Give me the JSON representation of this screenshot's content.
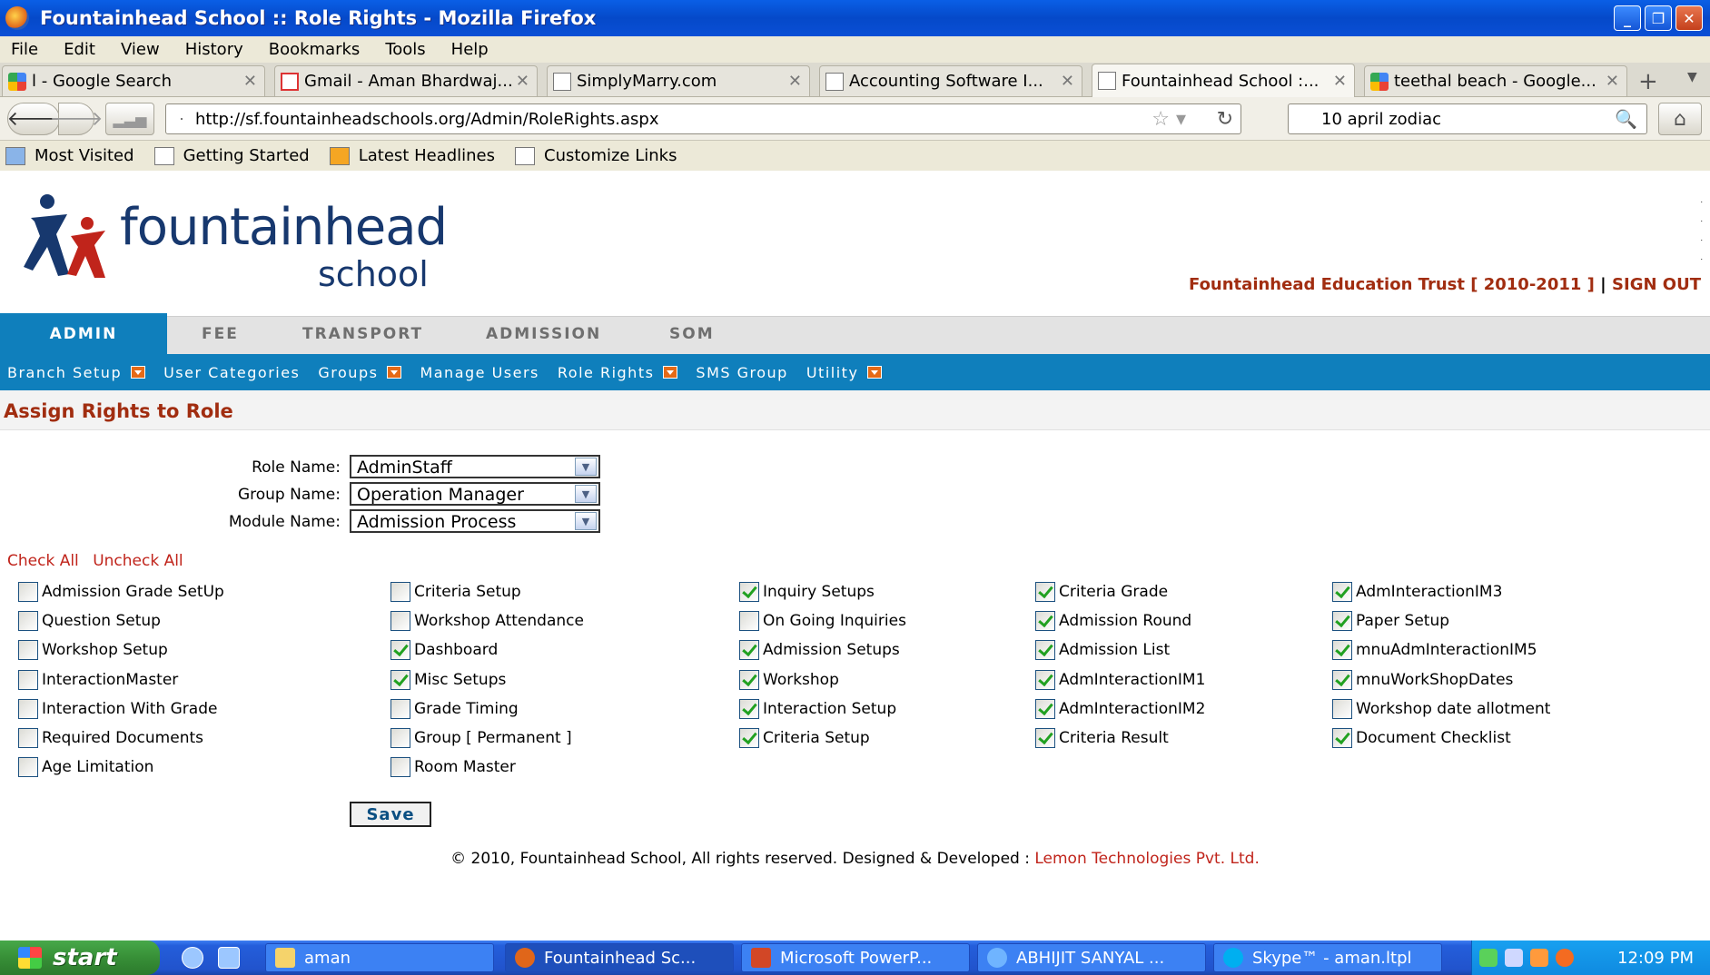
{
  "window": {
    "title": "Fountainhead School :: Role Rights - Mozilla Firefox"
  },
  "menubar": [
    "File",
    "Edit",
    "View",
    "History",
    "Bookmarks",
    "Tools",
    "Help"
  ],
  "tabs": [
    {
      "label": "l - Google Search",
      "icon": "google-icon",
      "active": false
    },
    {
      "label": "Gmail - Aman Bhardwaj...",
      "icon": "gmail-icon",
      "active": false
    },
    {
      "label": "SimplyMarry.com",
      "icon": "page-icon",
      "active": false
    },
    {
      "label": "Accounting Software I...",
      "icon": "page-icon",
      "active": false
    },
    {
      "label": "Fountainhead School :...",
      "icon": "page-icon",
      "active": true
    },
    {
      "label": "teethal beach - Google...",
      "icon": "google-icon",
      "active": false
    }
  ],
  "nav": {
    "url": "http://sf.fountainheadschools.org/Admin/RoleRights.aspx",
    "search": "10 april zodiac"
  },
  "bookmarks": [
    "Most Visited",
    "Getting Started",
    "Latest Headlines",
    "Customize Links"
  ],
  "site": {
    "logo_line1": "fountainhead",
    "logo_line2": "school",
    "trust": "Fountainhead Education Trust [ 2010-2011 ]",
    "separator": "|",
    "signout": "SIGN OUT"
  },
  "main_tabs": [
    "ADMIN",
    "FEE",
    "TRANSPORT",
    "ADMISSION",
    "SOM"
  ],
  "submenu": [
    {
      "label": "Branch Setup",
      "dropdown": true
    },
    {
      "label": "User Categories",
      "dropdown": false
    },
    {
      "label": "Groups",
      "dropdown": true
    },
    {
      "label": "Manage Users",
      "dropdown": false
    },
    {
      "label": "Role Rights",
      "dropdown": true
    },
    {
      "label": "SMS Group",
      "dropdown": false
    },
    {
      "label": "Utility",
      "dropdown": true
    }
  ],
  "form": {
    "heading": "Assign Rights to Role",
    "role_label": "Role Name:",
    "role_value": "AdminStaff",
    "group_label": "Group Name:",
    "group_value": "Operation Manager",
    "module_label": "Module Name:",
    "module_value": "Admission Process",
    "check_all": "Check All",
    "uncheck_all": "Uncheck All",
    "save": "Save"
  },
  "rights_columns": [
    [
      {
        "label": "Admission Grade SetUp",
        "checked": false
      },
      {
        "label": "Question Setup",
        "checked": false
      },
      {
        "label": "Workshop Setup",
        "checked": false
      },
      {
        "label": "InteractionMaster",
        "checked": false
      },
      {
        "label": "Interaction With Grade",
        "checked": false
      },
      {
        "label": "Required Documents",
        "checked": false
      },
      {
        "label": "Age Limitation",
        "checked": false
      }
    ],
    [
      {
        "label": "Criteria Setup",
        "checked": false
      },
      {
        "label": "Workshop Attendance",
        "checked": false
      },
      {
        "label": "Dashboard",
        "checked": true
      },
      {
        "label": "Misc Setups",
        "checked": true
      },
      {
        "label": "Grade Timing",
        "checked": false
      },
      {
        "label": "Group [ Permanent ]",
        "checked": false
      },
      {
        "label": "Room Master",
        "checked": false
      }
    ],
    [
      {
        "label": "Inquiry Setups",
        "checked": true
      },
      {
        "label": "On Going Inquiries",
        "checked": false
      },
      {
        "label": "Admission Setups",
        "checked": true
      },
      {
        "label": "Workshop",
        "checked": true
      },
      {
        "label": "Interaction Setup",
        "checked": true
      },
      {
        "label": "Criteria Setup",
        "checked": true
      }
    ],
    [
      {
        "label": "Criteria Grade",
        "checked": true
      },
      {
        "label": "Admission Round",
        "checked": true
      },
      {
        "label": "Admission List",
        "checked": true
      },
      {
        "label": "AdmInteractionIM1",
        "checked": true
      },
      {
        "label": "AdmInteractionIM2",
        "checked": true
      },
      {
        "label": "Criteria Result",
        "checked": true
      }
    ],
    [
      {
        "label": "AdmInteractionIM3",
        "checked": true
      },
      {
        "label": "Paper Setup",
        "checked": true
      },
      {
        "label": "mnuAdmInteractionIM5",
        "checked": true
      },
      {
        "label": "mnuWorkShopDates",
        "checked": true
      },
      {
        "label": "Workshop date allotment",
        "checked": false
      },
      {
        "label": "Document Checklist",
        "checked": true
      }
    ]
  ],
  "footer": {
    "text": "© 2010, Fountainhead School, All rights reserved. Designed & Developed :",
    "developer": "Lemon Technologies Pvt. Ltd."
  },
  "taskbar": {
    "start": "start",
    "tasks": [
      {
        "label": "aman",
        "active": false
      },
      {
        "label": "Fountainhead Sc...",
        "active": true
      },
      {
        "label": "Microsoft PowerP...",
        "active": false
      },
      {
        "label": "ABHIJIT SANYAL ...",
        "active": false
      },
      {
        "label": "Skype™ - aman.ltpl",
        "active": false
      }
    ],
    "clock": "12:09 PM"
  }
}
